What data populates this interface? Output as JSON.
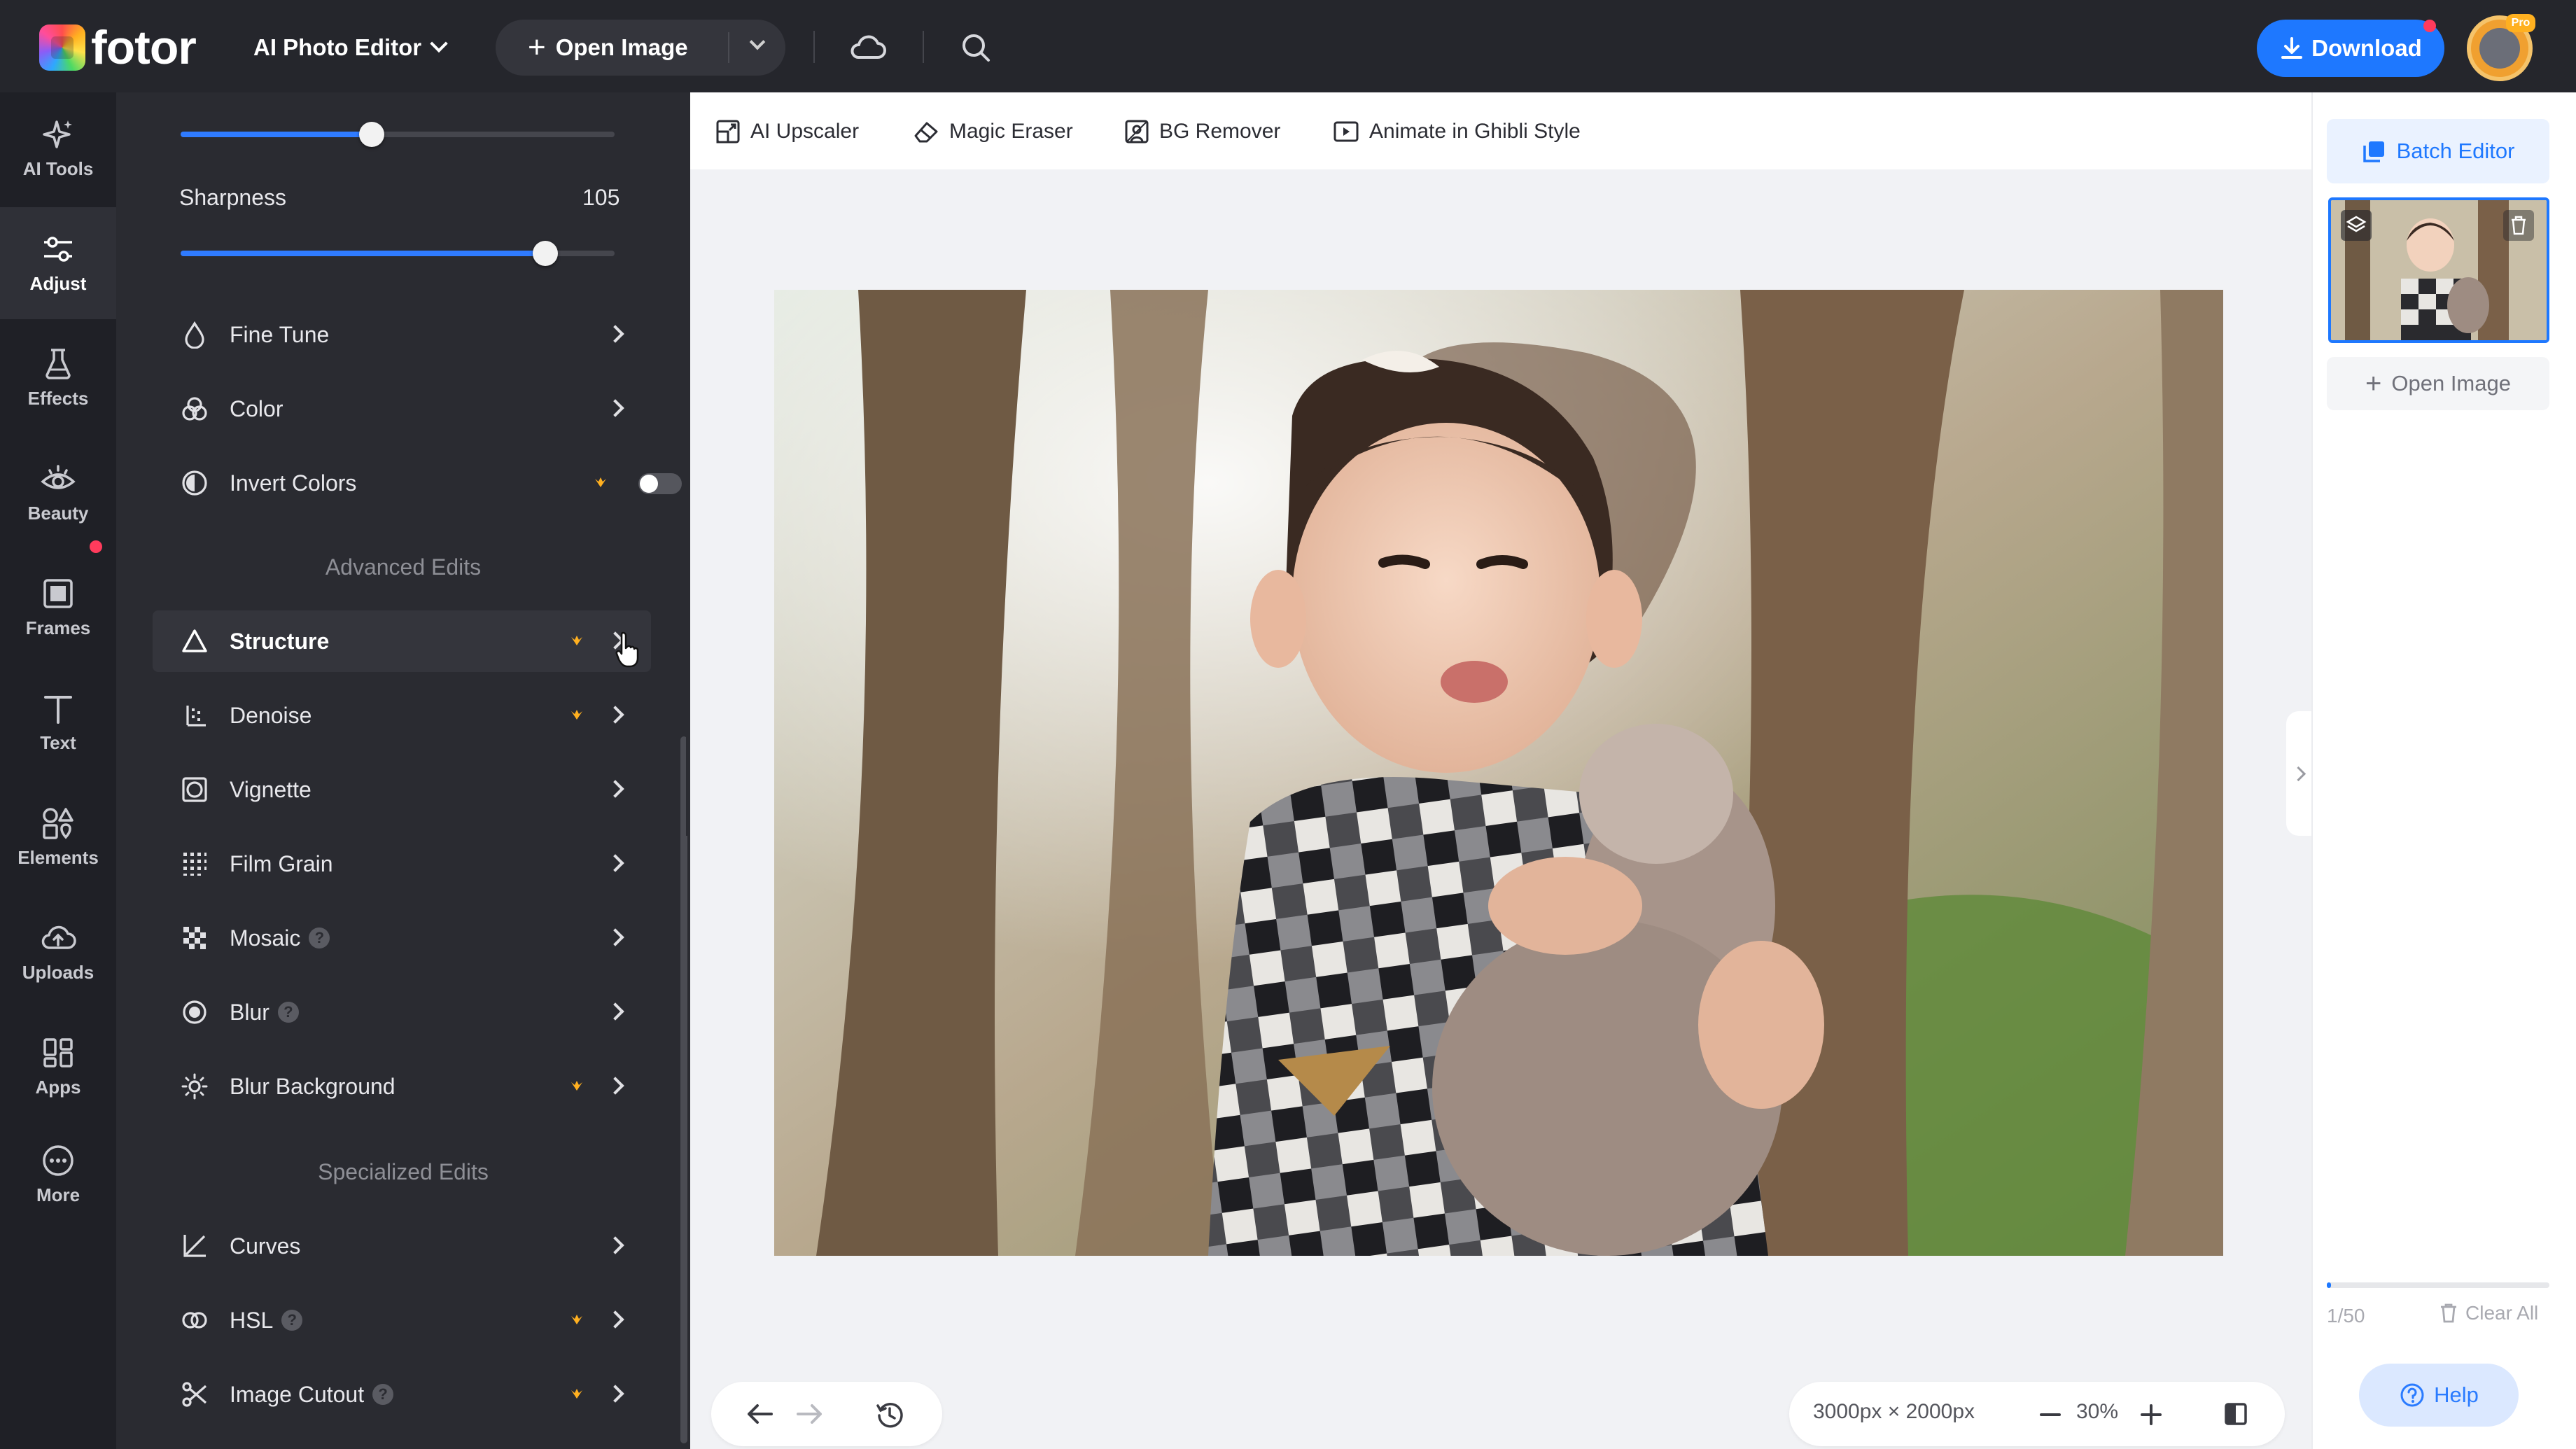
{
  "topbar": {
    "brand": "fotor",
    "editor_menu": "AI Photo Editor",
    "open_image": "Open Image",
    "download": "Download",
    "avatar_badge": "Pro",
    "icons": [
      "cloud-icon",
      "search-icon"
    ]
  },
  "rail": {
    "items": [
      {
        "label": "AI Tools",
        "icon": "sparkle-icon"
      },
      {
        "label": "Adjust",
        "icon": "sliders-icon"
      },
      {
        "label": "Effects",
        "icon": "flask-icon"
      },
      {
        "label": "Beauty",
        "icon": "eye-icon"
      },
      {
        "label": "Frames",
        "icon": "frame-icon"
      },
      {
        "label": "Text",
        "icon": "text-icon"
      },
      {
        "label": "Elements",
        "icon": "shapes-icon"
      },
      {
        "label": "Uploads",
        "icon": "upload-icon"
      },
      {
        "label": "Apps",
        "icon": "apps-icon"
      },
      {
        "label": "More",
        "icon": "more-icon"
      }
    ],
    "active": "Adjust"
  },
  "panel": {
    "top_slider_fraction": 0.44,
    "sharpness": {
      "label": "Sharpness",
      "value": "105",
      "fraction": 0.84
    },
    "basic_items": [
      {
        "label": "Fine Tune",
        "icon": "drop-icon"
      },
      {
        "label": "Color",
        "icon": "palette-icon"
      },
      {
        "label": "Invert Colors",
        "icon": "invert-icon",
        "premium": true,
        "toggle": "off"
      }
    ],
    "advanced_title": "Advanced Edits",
    "advanced_items": [
      {
        "label": "Structure",
        "icon": "triangle-icon",
        "premium": true
      },
      {
        "label": "Denoise",
        "icon": "denoise-icon",
        "premium": true
      },
      {
        "label": "Vignette",
        "icon": "vignette-icon"
      },
      {
        "label": "Film Grain",
        "icon": "grain-icon"
      },
      {
        "label": "Mosaic",
        "icon": "mosaic-icon",
        "help": true
      },
      {
        "label": "Blur",
        "icon": "blur-icon",
        "help": true
      },
      {
        "label": "Blur Background",
        "icon": "blur-bg-icon",
        "premium": true
      }
    ],
    "specialized_title": "Specialized Edits",
    "specialized_items": [
      {
        "label": "Curves",
        "icon": "curves-icon"
      },
      {
        "label": "HSL",
        "icon": "hsl-icon",
        "premium": true,
        "help": true
      },
      {
        "label": "Image Cutout",
        "icon": "scissors-icon",
        "premium": true,
        "help": true
      }
    ],
    "help_glyph": "?"
  },
  "toolbar": {
    "tools": [
      {
        "label": "AI Upscaler",
        "icon": "upscale-icon"
      },
      {
        "label": "Magic Eraser",
        "icon": "eraser-icon"
      },
      {
        "label": "BG Remover",
        "icon": "bg-remove-icon"
      },
      {
        "label": "Animate in Ghibli Style",
        "icon": "animate-icon"
      }
    ]
  },
  "canvas": {
    "dimensions": "3000px × 2000px",
    "zoom": "30%"
  },
  "right_panel": {
    "batch_editor": "Batch Editor",
    "open_image": "Open Image",
    "count": "1/50",
    "progress_fraction": 0.02,
    "clear_all": "Clear All",
    "help": "Help"
  },
  "colors": {
    "accent": "#1e78ff",
    "topbar_bg": "#25262c",
    "panel_bg": "#2a2b31",
    "premium": "#ffb020"
  }
}
